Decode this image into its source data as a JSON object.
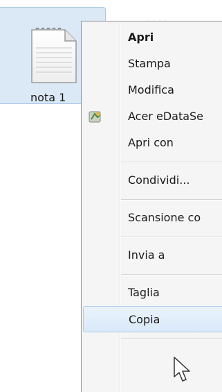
{
  "files": [
    {
      "name": "nota 1"
    }
  ],
  "context_menu": {
    "items": [
      {
        "label": "Apri",
        "bold": true
      },
      {
        "label": "Stampa"
      },
      {
        "label": "Modifica"
      },
      {
        "label": "Acer eDataSe",
        "icon": "acer-edatasecurity-icon"
      },
      {
        "label": "Apri con"
      },
      {
        "label": "Condividi..."
      },
      {
        "label": "Scansione co"
      },
      {
        "label": "Invia a"
      },
      {
        "label": "Taglia"
      },
      {
        "label": "Copia",
        "highlighted": true
      }
    ]
  },
  "colors": {
    "selection_fill": "#dbe9f6",
    "menu_background": "#f5f5f5",
    "menu_highlight": "#d9e9f9"
  }
}
